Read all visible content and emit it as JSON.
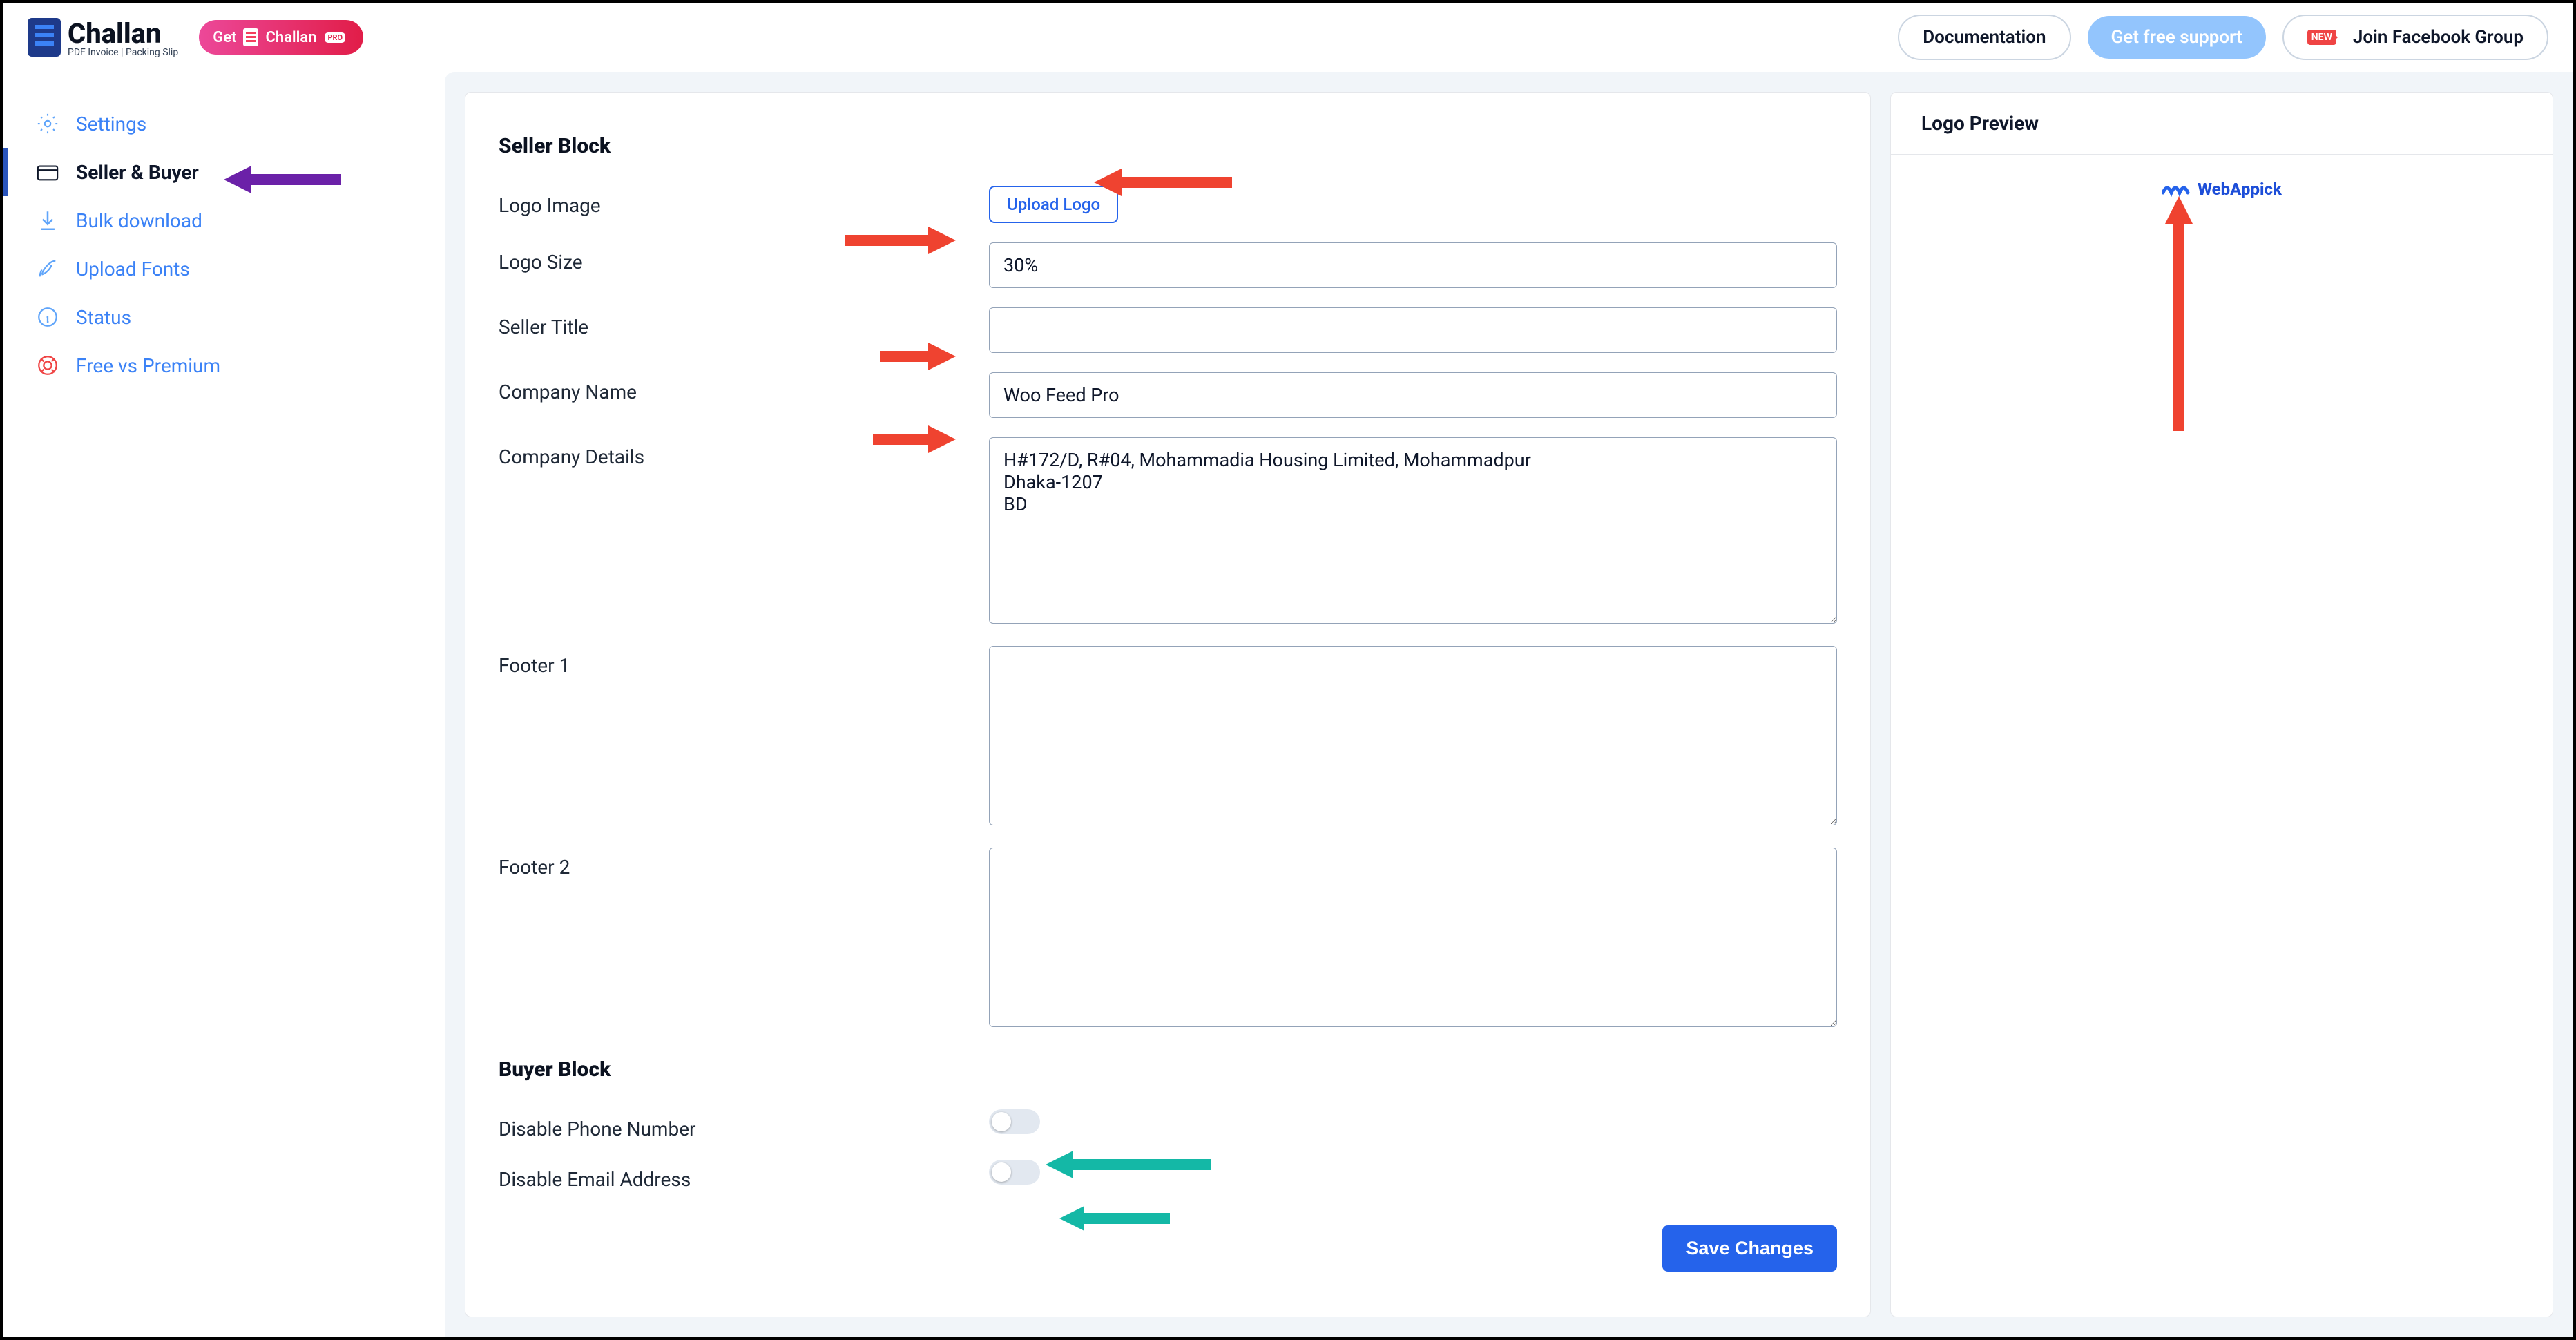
{
  "brand": {
    "name": "Challan",
    "sub": "PDF Invoice | Packing Slip"
  },
  "getPill": {
    "prefix": "Get",
    "name": "Challan",
    "badge": "PRO"
  },
  "topbar": {
    "documentation": "Documentation",
    "freeSupport": "Get free support",
    "fbGroup": "Join Facebook Group",
    "newBadge": "NEW"
  },
  "sidebar": {
    "items": [
      {
        "label": "Settings"
      },
      {
        "label": "Seller & Buyer"
      },
      {
        "label": "Bulk download"
      },
      {
        "label": "Upload Fonts"
      },
      {
        "label": "Status"
      },
      {
        "label": "Free vs Premium"
      }
    ]
  },
  "preview": {
    "header": "Logo Preview",
    "logoText": "WebAppick"
  },
  "seller": {
    "section": "Seller Block",
    "logoImageLabel": "Logo Image",
    "uploadLogo": "Upload Logo",
    "logoSizeLabel": "Logo Size",
    "logoSizeValue": "30%",
    "sellerTitleLabel": "Seller Title",
    "sellerTitleValue": "",
    "companyNameLabel": "Company Name",
    "companyNameValue": "Woo Feed Pro",
    "companyDetailsLabel": "Company Details",
    "companyDetailsValue": "H#172/D, R#04, Mohammadia Housing Limited, Mohammadpur\nDhaka-1207\nBD",
    "footer1Label": "Footer 1",
    "footer1Value": "",
    "footer2Label": "Footer 2",
    "footer2Value": ""
  },
  "buyer": {
    "section": "Buyer Block",
    "disablePhoneLabel": "Disable Phone Number",
    "disableEmailLabel": "Disable Email Address"
  },
  "actions": {
    "save": "Save Changes"
  }
}
